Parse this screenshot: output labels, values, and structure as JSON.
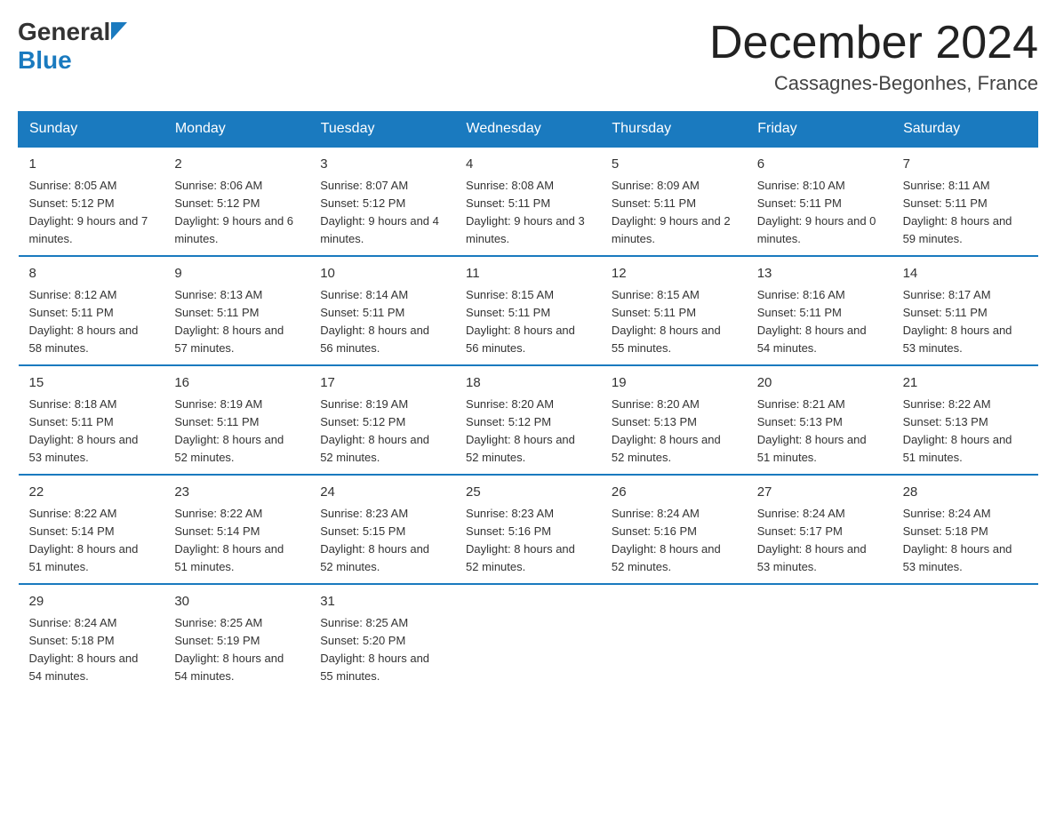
{
  "header": {
    "logo": {
      "general": "General",
      "blue": "Blue",
      "arrow_color": "#1a7abf"
    },
    "title": "December 2024",
    "location": "Cassagnes-Begonhes, France"
  },
  "calendar": {
    "days_of_week": [
      "Sunday",
      "Monday",
      "Tuesday",
      "Wednesday",
      "Thursday",
      "Friday",
      "Saturday"
    ],
    "weeks": [
      [
        {
          "day": "1",
          "sunrise": "8:05 AM",
          "sunset": "5:12 PM",
          "daylight": "9 hours and 7 minutes."
        },
        {
          "day": "2",
          "sunrise": "8:06 AM",
          "sunset": "5:12 PM",
          "daylight": "9 hours and 6 minutes."
        },
        {
          "day": "3",
          "sunrise": "8:07 AM",
          "sunset": "5:12 PM",
          "daylight": "9 hours and 4 minutes."
        },
        {
          "day": "4",
          "sunrise": "8:08 AM",
          "sunset": "5:11 PM",
          "daylight": "9 hours and 3 minutes."
        },
        {
          "day": "5",
          "sunrise": "8:09 AM",
          "sunset": "5:11 PM",
          "daylight": "9 hours and 2 minutes."
        },
        {
          "day": "6",
          "sunrise": "8:10 AM",
          "sunset": "5:11 PM",
          "daylight": "9 hours and 0 minutes."
        },
        {
          "day": "7",
          "sunrise": "8:11 AM",
          "sunset": "5:11 PM",
          "daylight": "8 hours and 59 minutes."
        }
      ],
      [
        {
          "day": "8",
          "sunrise": "8:12 AM",
          "sunset": "5:11 PM",
          "daylight": "8 hours and 58 minutes."
        },
        {
          "day": "9",
          "sunrise": "8:13 AM",
          "sunset": "5:11 PM",
          "daylight": "8 hours and 57 minutes."
        },
        {
          "day": "10",
          "sunrise": "8:14 AM",
          "sunset": "5:11 PM",
          "daylight": "8 hours and 56 minutes."
        },
        {
          "day": "11",
          "sunrise": "8:15 AM",
          "sunset": "5:11 PM",
          "daylight": "8 hours and 56 minutes."
        },
        {
          "day": "12",
          "sunrise": "8:15 AM",
          "sunset": "5:11 PM",
          "daylight": "8 hours and 55 minutes."
        },
        {
          "day": "13",
          "sunrise": "8:16 AM",
          "sunset": "5:11 PM",
          "daylight": "8 hours and 54 minutes."
        },
        {
          "day": "14",
          "sunrise": "8:17 AM",
          "sunset": "5:11 PM",
          "daylight": "8 hours and 53 minutes."
        }
      ],
      [
        {
          "day": "15",
          "sunrise": "8:18 AM",
          "sunset": "5:11 PM",
          "daylight": "8 hours and 53 minutes."
        },
        {
          "day": "16",
          "sunrise": "8:19 AM",
          "sunset": "5:11 PM",
          "daylight": "8 hours and 52 minutes."
        },
        {
          "day": "17",
          "sunrise": "8:19 AM",
          "sunset": "5:12 PM",
          "daylight": "8 hours and 52 minutes."
        },
        {
          "day": "18",
          "sunrise": "8:20 AM",
          "sunset": "5:12 PM",
          "daylight": "8 hours and 52 minutes."
        },
        {
          "day": "19",
          "sunrise": "8:20 AM",
          "sunset": "5:13 PM",
          "daylight": "8 hours and 52 minutes."
        },
        {
          "day": "20",
          "sunrise": "8:21 AM",
          "sunset": "5:13 PM",
          "daylight": "8 hours and 51 minutes."
        },
        {
          "day": "21",
          "sunrise": "8:22 AM",
          "sunset": "5:13 PM",
          "daylight": "8 hours and 51 minutes."
        }
      ],
      [
        {
          "day": "22",
          "sunrise": "8:22 AM",
          "sunset": "5:14 PM",
          "daylight": "8 hours and 51 minutes."
        },
        {
          "day": "23",
          "sunrise": "8:22 AM",
          "sunset": "5:14 PM",
          "daylight": "8 hours and 51 minutes."
        },
        {
          "day": "24",
          "sunrise": "8:23 AM",
          "sunset": "5:15 PM",
          "daylight": "8 hours and 52 minutes."
        },
        {
          "day": "25",
          "sunrise": "8:23 AM",
          "sunset": "5:16 PM",
          "daylight": "8 hours and 52 minutes."
        },
        {
          "day": "26",
          "sunrise": "8:24 AM",
          "sunset": "5:16 PM",
          "daylight": "8 hours and 52 minutes."
        },
        {
          "day": "27",
          "sunrise": "8:24 AM",
          "sunset": "5:17 PM",
          "daylight": "8 hours and 53 minutes."
        },
        {
          "day": "28",
          "sunrise": "8:24 AM",
          "sunset": "5:18 PM",
          "daylight": "8 hours and 53 minutes."
        }
      ],
      [
        {
          "day": "29",
          "sunrise": "8:24 AM",
          "sunset": "5:18 PM",
          "daylight": "8 hours and 54 minutes."
        },
        {
          "day": "30",
          "sunrise": "8:25 AM",
          "sunset": "5:19 PM",
          "daylight": "8 hours and 54 minutes."
        },
        {
          "day": "31",
          "sunrise": "8:25 AM",
          "sunset": "5:20 PM",
          "daylight": "8 hours and 55 minutes."
        },
        null,
        null,
        null,
        null
      ]
    ],
    "labels": {
      "sunrise": "Sunrise:",
      "sunset": "Sunset:",
      "daylight": "Daylight:"
    }
  }
}
